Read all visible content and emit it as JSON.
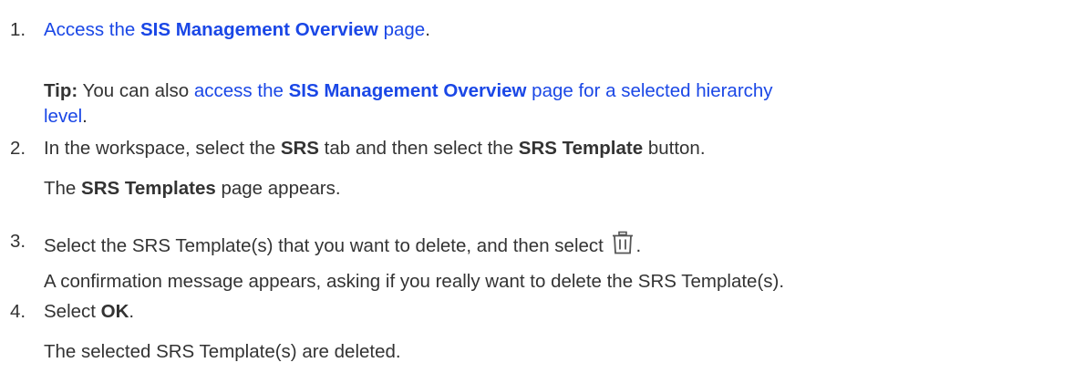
{
  "steps": [
    {
      "number": "1.",
      "link_prefix": "Access the ",
      "link_bold": "SIS Management Overview",
      "link_suffix": " page",
      "after_link": ".",
      "tip": {
        "label": "Tip:",
        "text": " You can also ",
        "link_prefix": "access the ",
        "link_bold": "SIS Management Overview",
        "link_suffix_line1": " page for a selected hierarchy",
        "link_suffix_line2": "level",
        "after_link": "."
      }
    },
    {
      "number": "2.",
      "text_1": "In the workspace, select the ",
      "bold_1": "SRS",
      "text_2": " tab and then select the ",
      "bold_2": "SRS Template",
      "text_3": " button.",
      "result_prefix": "The ",
      "result_bold": "SRS Templates",
      "result_suffix": " page appears."
    },
    {
      "number": "3.",
      "text": "Select the SRS Template(s) that you want to delete, and then select ",
      "icon": "trash-icon",
      "after_icon": ".",
      "result": "A confirmation message appears, asking if you really want to delete the SRS Template(s)."
    },
    {
      "number": "4.",
      "text_1": "Select ",
      "bold": "OK",
      "text_2": ".",
      "result": "The selected SRS Template(s) are deleted."
    }
  ],
  "colors": {
    "text": "#333333",
    "link": "#1a47e6"
  }
}
